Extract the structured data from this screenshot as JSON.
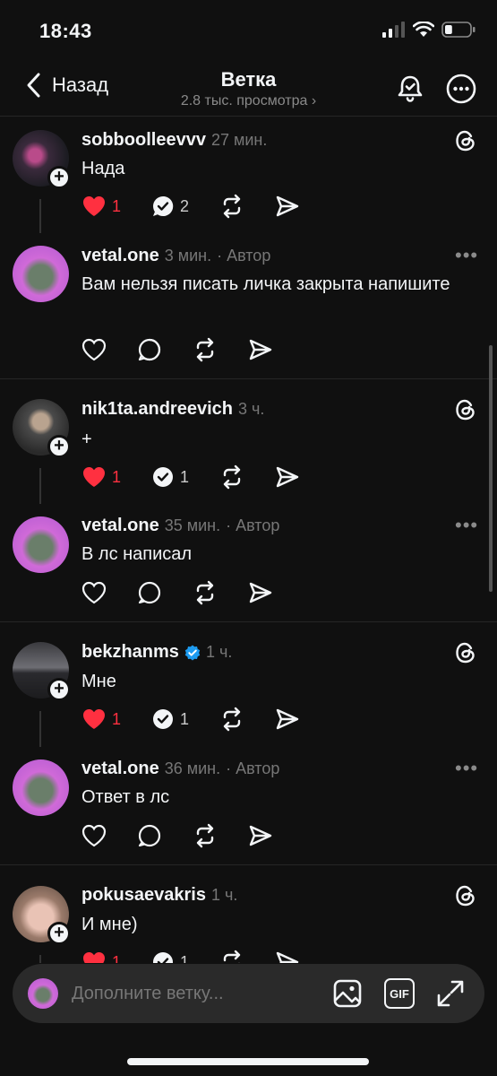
{
  "status_bar": {
    "time": "18:43",
    "battery_percent": 30
  },
  "header": {
    "back_label": "Назад",
    "title": "Ветка",
    "views": "2.8 тыс. просмотра",
    "views_chevron": "›"
  },
  "colors": {
    "background": "#101010",
    "like_red": "#ff3040",
    "verified_blue": "#1d9bf0"
  },
  "posts": [
    {
      "username": "sobboolleevvv",
      "time": "27 мин.",
      "text": "Нада",
      "likes": "1",
      "replies": "2",
      "icon": "threads-logo-icon"
    },
    {
      "username": "vetal.one",
      "time": "3 мин.",
      "author": "· Автор",
      "text": "Вам нельзя писать личка закрыта напишите"
    },
    {
      "username": "nik1ta.andreevich",
      "time": "3 ч.",
      "text": "+",
      "likes": "1",
      "replies": "1",
      "icon": "threads-logo-icon"
    },
    {
      "username": "vetal.one",
      "time": "35 мин.",
      "author": "· Автор",
      "text": "В лс написал"
    },
    {
      "username": "bekzhanms",
      "time": "1 ч.",
      "text": "Мне",
      "likes": "1",
      "replies": "1",
      "verified": true,
      "icon": "threads-logo-icon"
    },
    {
      "username": "vetal.one",
      "time": "36 мин.",
      "author": "· Автор",
      "text": "Ответ в лс"
    },
    {
      "username": "pokusaevakris",
      "time": "1 ч.",
      "text": "И мне)",
      "likes": "1",
      "replies": "1",
      "icon": "threads-logo-icon"
    }
  ],
  "plus_glyph": "+",
  "more_glyph": "•••",
  "compose": {
    "placeholder": "Дополните ветку...",
    "gif_label": "GIF"
  }
}
